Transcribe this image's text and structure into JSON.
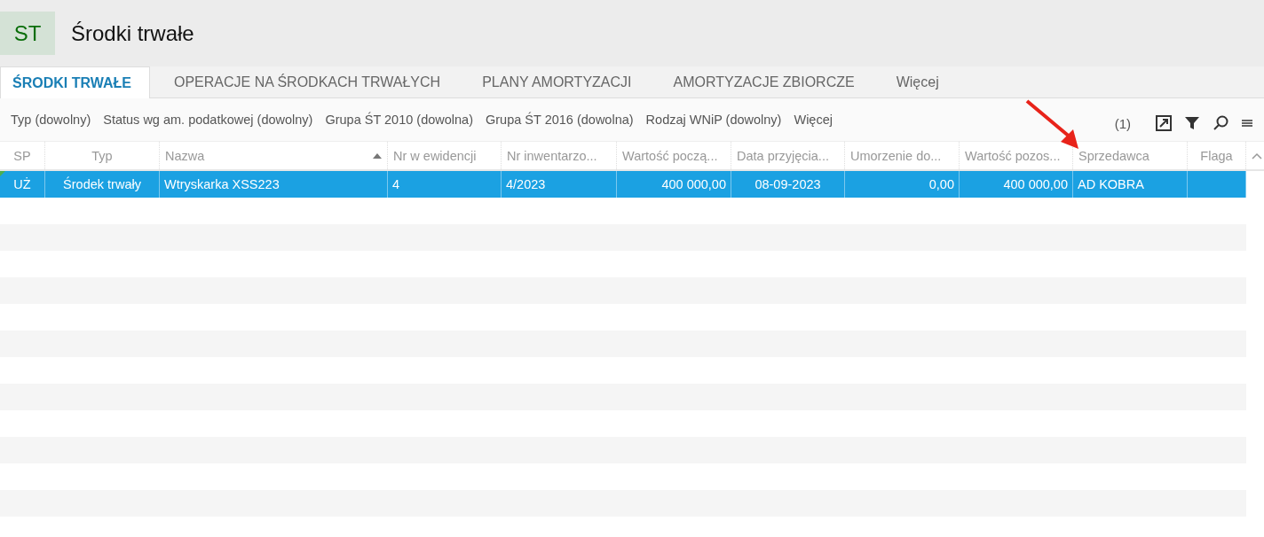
{
  "header": {
    "badge": "ST",
    "title": "Środki trwałe"
  },
  "tabs": [
    {
      "label": "ŚRODKI TRWAŁE",
      "selected": true
    },
    {
      "label": "OPERACJE NA ŚRODKACH TRWAŁYCH",
      "selected": false
    },
    {
      "label": "PLANY AMORTYZACJI",
      "selected": false
    },
    {
      "label": "AMORTYZACJE ZBIORCZE",
      "selected": false
    },
    {
      "label": "Więcej",
      "selected": false
    }
  ],
  "filters": [
    "Typ (dowolny)",
    "Status wg am. podatkowej (dowolny)",
    "Grupa ŚT 2010 (dowolna)",
    "Grupa ŚT 2016 (dowolna)",
    "Rodzaj WNiP (dowolny)",
    "Więcej"
  ],
  "toolbar": {
    "count": "(1)"
  },
  "table": {
    "columns": [
      {
        "label": "SP",
        "sorted": false
      },
      {
        "label": "Typ",
        "sorted": false
      },
      {
        "label": "Nazwa",
        "sorted": true
      },
      {
        "label": "Nr w ewidencji",
        "sorted": false
      },
      {
        "label": "Nr inwentarzo...",
        "sorted": false
      },
      {
        "label": "Wartość począ...",
        "sorted": false
      },
      {
        "label": "Data przyjęcia...",
        "sorted": false
      },
      {
        "label": "Umorzenie do...",
        "sorted": false
      },
      {
        "label": "Wartość pozos...",
        "sorted": false
      },
      {
        "label": "Sprzedawca",
        "sorted": false
      },
      {
        "label": "Flaga",
        "sorted": false
      }
    ],
    "rows": [
      {
        "selected": true,
        "cells": [
          "UŻ",
          "Środek trwały",
          "Wtryskarka XSS223",
          "4",
          "4/2023",
          "400 000,00",
          "08-09-2023",
          "0,00",
          "400 000,00",
          "AD KOBRA"
        ]
      }
    ]
  }
}
